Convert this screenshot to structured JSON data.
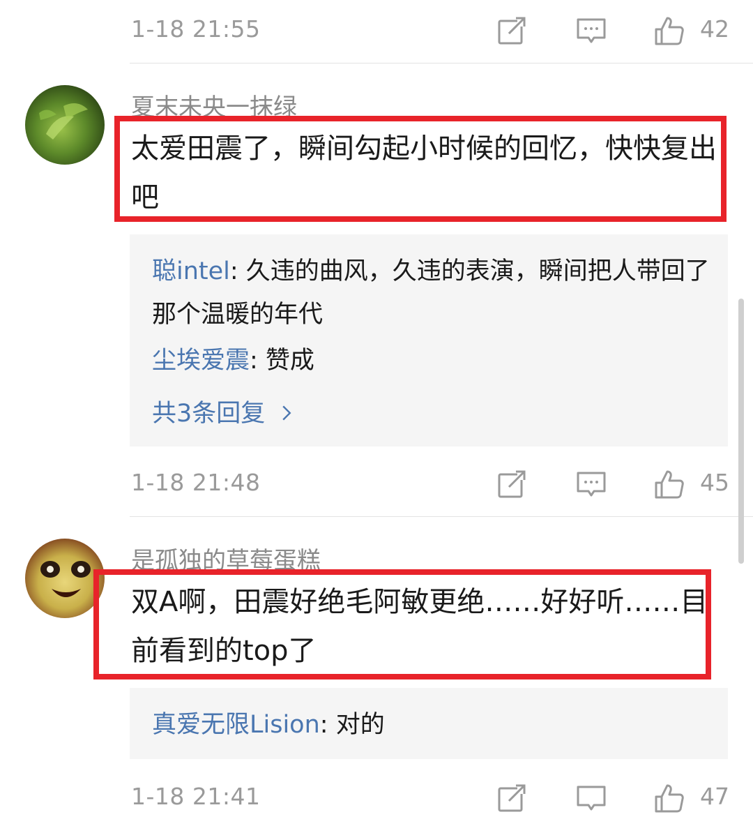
{
  "colors": {
    "highlight": "#e8232a",
    "link": "#4a76b0",
    "meta": "#9a9a9a",
    "reply_bg": "#f5f5f5"
  },
  "icons": {
    "share": "share-icon",
    "comment": "comment-icon",
    "like": "thumbs-up-icon",
    "chevron": "chevron-right-icon"
  },
  "top_meta": {
    "time": "1-18 21:55",
    "likes": "42"
  },
  "comments": [
    {
      "user": "夏末未央一抹绿",
      "text": "太爱田震了，瞬间勾起小时候的回忆，快快复出吧",
      "replies": [
        {
          "user": "聪intel",
          "text": ": 久违的曲风，久违的表演，瞬间把人带回了那个温暖的年代"
        },
        {
          "user": "尘埃爱震",
          "text": ": 赞成"
        }
      ],
      "more_replies": "共3条回复",
      "time": "1-18 21:48",
      "likes": "45"
    },
    {
      "user": "是孤独的草莓蛋糕",
      "text": "双A啊，田震好绝毛阿敏更绝……好好听……目前看到的top了",
      "replies": [
        {
          "user": "真爱无限Lision",
          "text": ": 对的"
        }
      ],
      "time": "1-18 21:41",
      "likes": "47"
    }
  ]
}
